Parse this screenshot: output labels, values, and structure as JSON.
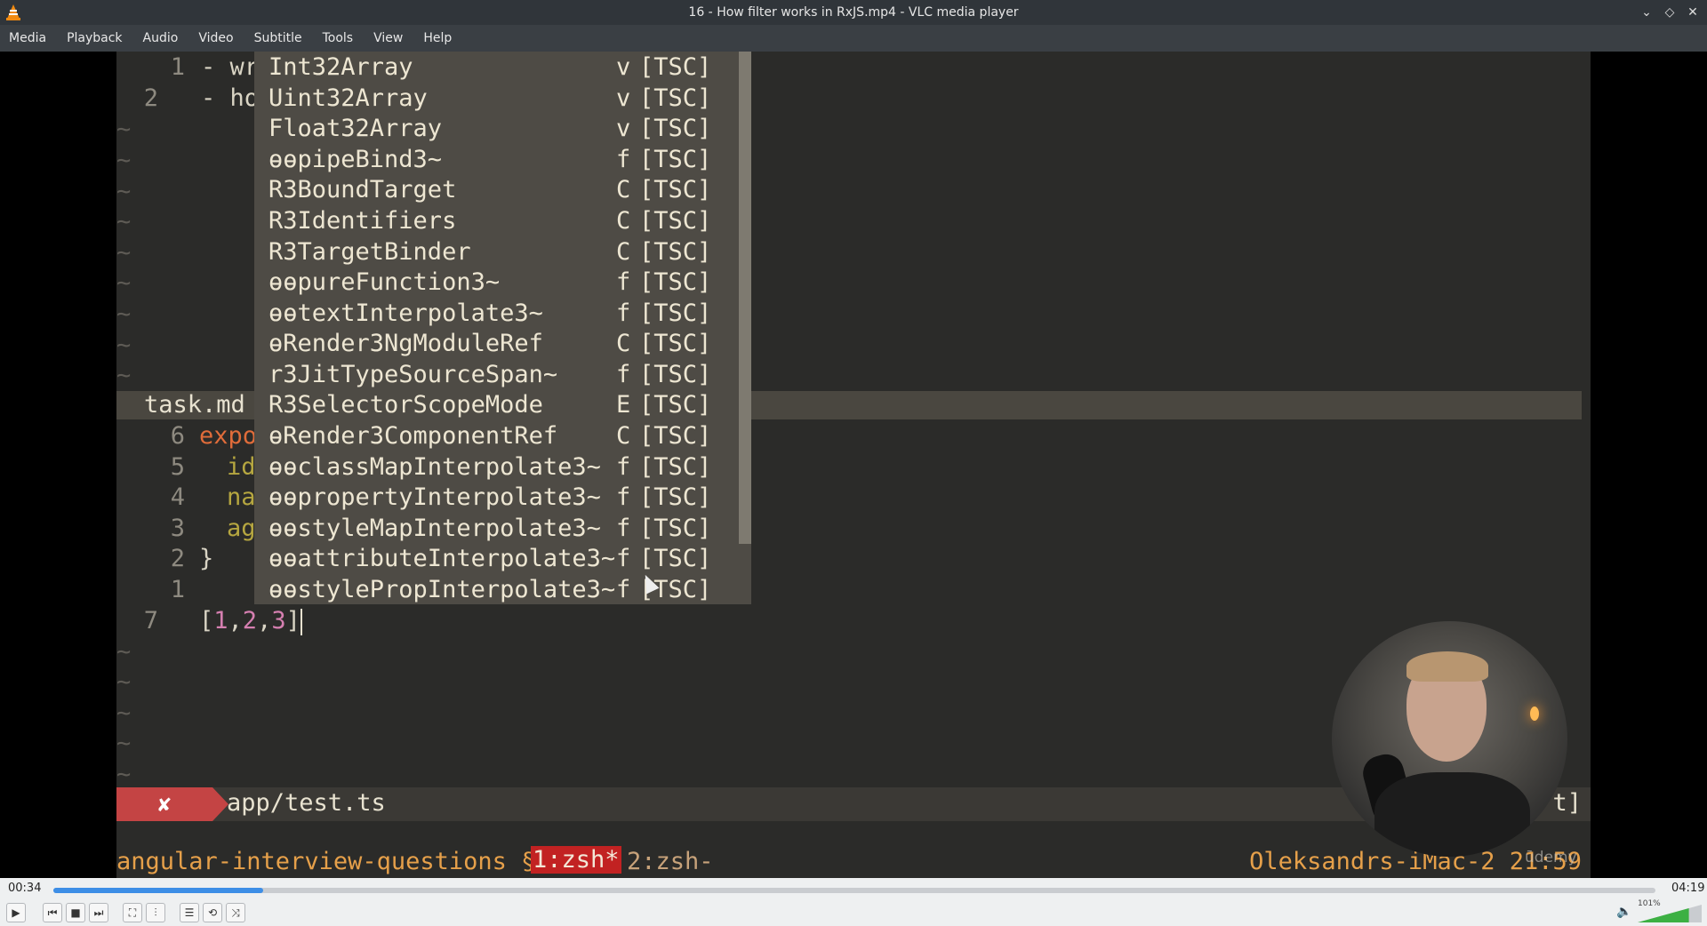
{
  "window": {
    "title": "16 - How filter works in RxJS.mp4 - VLC media player",
    "buttons": [
      "⌄",
      "◇",
      "✕"
    ]
  },
  "menu": [
    "Media",
    "Playback",
    "Audio",
    "Video",
    "Subtitle",
    "Tools",
    "View",
    "Help"
  ],
  "editor": {
    "top_lines": [
      {
        "num": "1",
        "text": "- wr"
      },
      {
        "num": "2",
        "text": "- ho"
      }
    ],
    "status_file": "task.md",
    "code_lines": [
      {
        "num": "6",
        "text": "expo"
      },
      {
        "num": "5",
        "text": "id"
      },
      {
        "num": "4",
        "text": "na"
      },
      {
        "num": "3",
        "text": "ag"
      },
      {
        "num": "2",
        "text": "}"
      },
      {
        "num": "1",
        "text": ""
      }
    ],
    "current_line": {
      "num": "7",
      "open": "[",
      "n1": "1",
      "c1": ",",
      "n2": "2",
      "c2": ",",
      "n3": "3",
      "close": "]"
    },
    "error_mark": "✘",
    "error_path": "app/test.ts",
    "error_tail": "t]",
    "tmux_session": "angular-interview-questions §",
    "tmux_win1": "1:zsh*",
    "tmux_win2": "2:zsh-",
    "tmux_host": "Oleksandrs-iMac-2 21:59",
    "watermark": "ūdemy"
  },
  "completions": [
    {
      "name": "Int32Array",
      "kind": "v",
      "src": "[TSC]"
    },
    {
      "name": "Uint32Array",
      "kind": "v",
      "src": "[TSC]"
    },
    {
      "name": "Float32Array",
      "kind": "v",
      "src": "[TSC]"
    },
    {
      "name": "ɵɵpipeBind3~",
      "kind": "f",
      "src": "[TSC]"
    },
    {
      "name": "R3BoundTarget",
      "kind": "C",
      "src": "[TSC]"
    },
    {
      "name": "R3Identifiers",
      "kind": "C",
      "src": "[TSC]"
    },
    {
      "name": "R3TargetBinder",
      "kind": "C",
      "src": "[TSC]"
    },
    {
      "name": "ɵɵpureFunction3~",
      "kind": "f",
      "src": "[TSC]"
    },
    {
      "name": "ɵɵtextInterpolate3~",
      "kind": "f",
      "src": "[TSC]"
    },
    {
      "name": "ɵRender3NgModuleRef",
      "kind": "C",
      "src": "[TSC]"
    },
    {
      "name": "r3JitTypeSourceSpan~",
      "kind": "f",
      "src": "[TSC]"
    },
    {
      "name": "R3SelectorScopeMode",
      "kind": "E",
      "src": "[TSC]"
    },
    {
      "name": "ɵRender3ComponentRef",
      "kind": "C",
      "src": "[TSC]"
    },
    {
      "name": "ɵɵclassMapInterpolate3~",
      "kind": "f",
      "src": "[TSC]"
    },
    {
      "name": "ɵɵpropertyInterpolate3~",
      "kind": "f",
      "src": "[TSC]"
    },
    {
      "name": "ɵɵstyleMapInterpolate3~",
      "kind": "f",
      "src": "[TSC]"
    },
    {
      "name": "ɵɵattributeInterpolate3~",
      "kind": "f",
      "src": "[TSC]"
    },
    {
      "name": "ɵɵstylePropInterpolate3~",
      "kind": "f",
      "src": "[TSC]"
    }
  ],
  "player": {
    "elapsed": "00:34",
    "total": "04:19",
    "progress_fraction": 0.131,
    "volume_label": "101%",
    "volume_fraction": 0.8
  },
  "colors": {
    "progress": "#3d8ee6",
    "volume": "#3cb043",
    "error": "#c44444",
    "tmux_active": "#c22222"
  },
  "icons": {
    "play": "▶",
    "prev": "⏮",
    "stop": "■",
    "next": "⏭",
    "fullscreen": "⛶",
    "extended": "⫶",
    "playlist": "☰",
    "loop": "⟲",
    "shuffle": "⤨",
    "volume": "🔈"
  }
}
